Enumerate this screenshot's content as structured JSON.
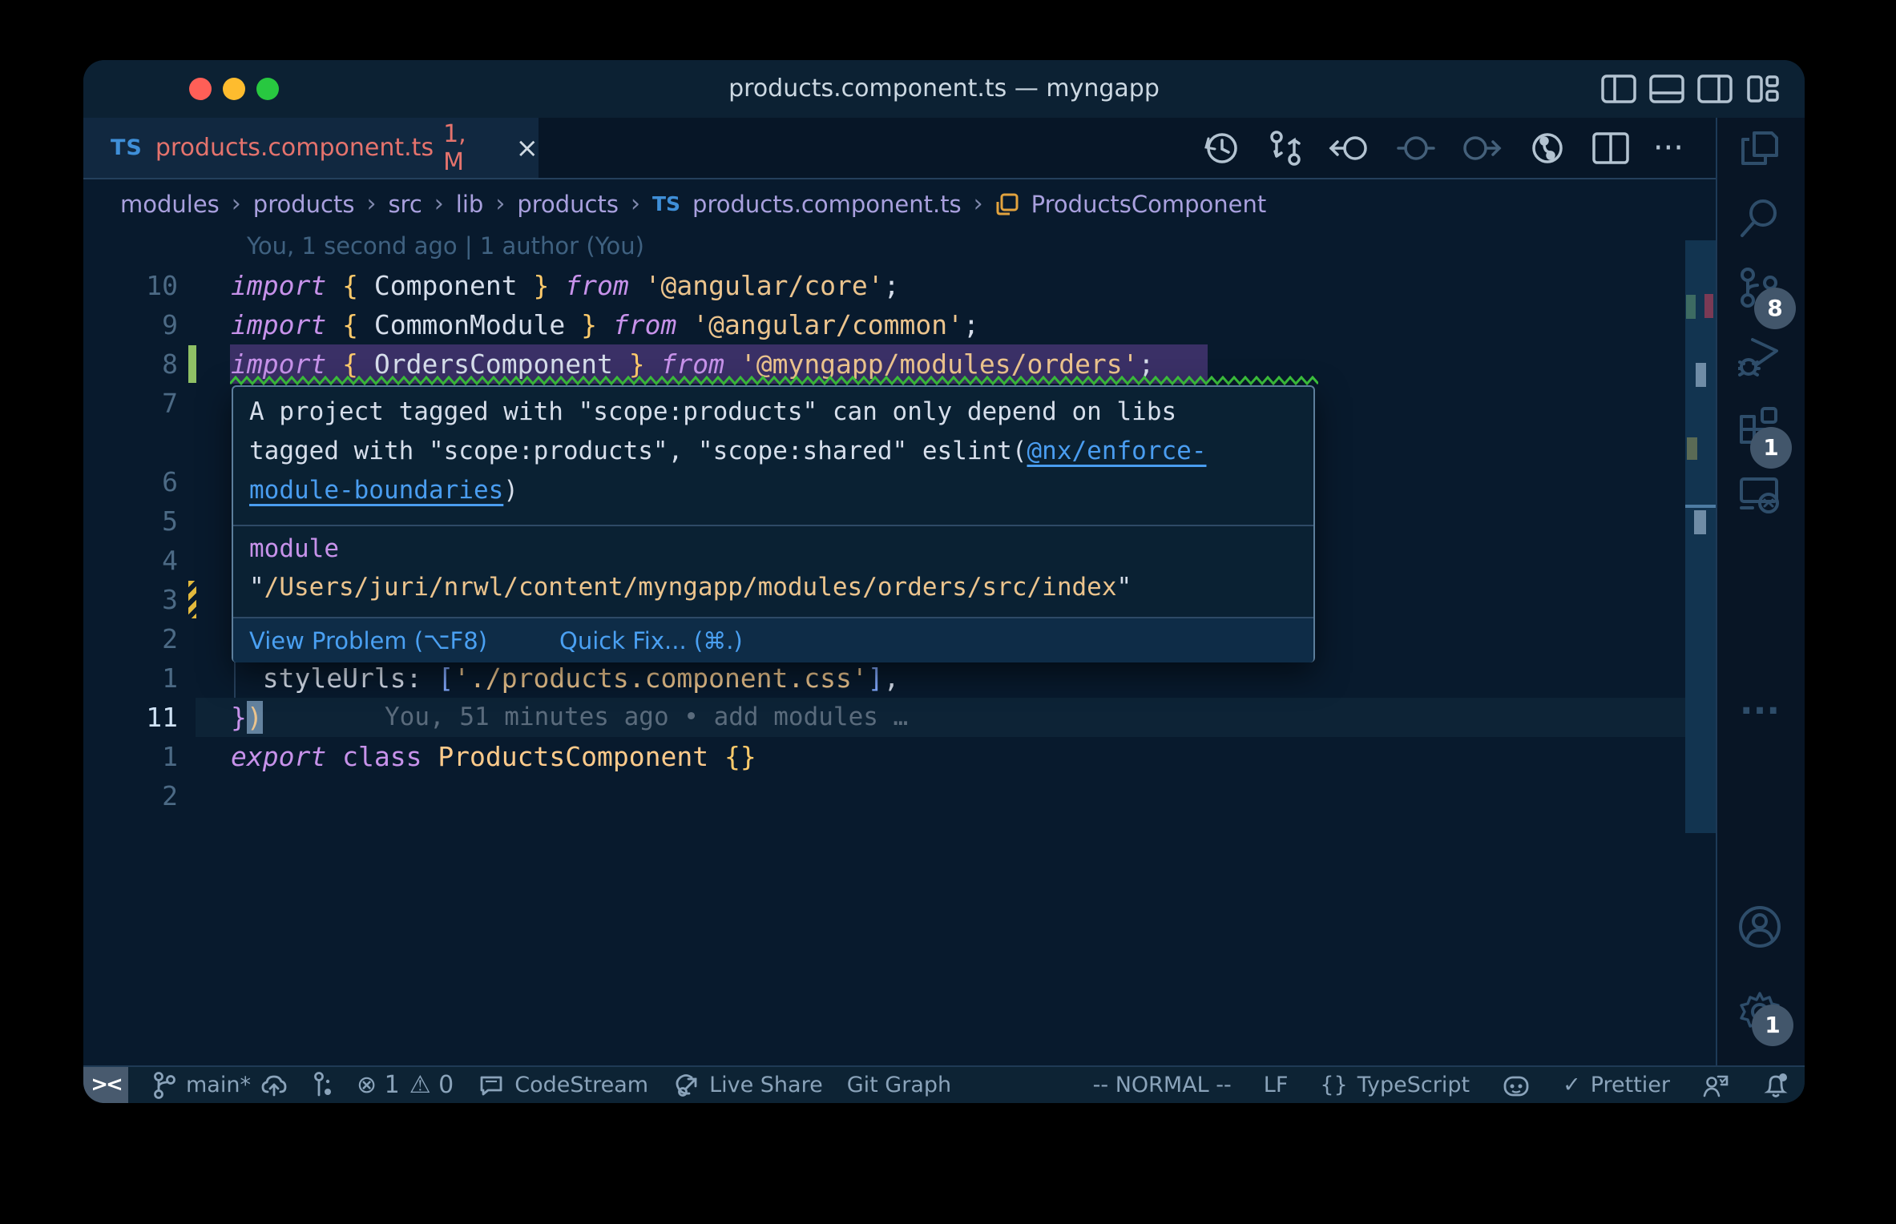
{
  "window": {
    "title": "products.component.ts — myngapp"
  },
  "tab": {
    "type": "TS",
    "label": "products.component.ts",
    "badge": "1, M",
    "close": "×"
  },
  "breadcrumb": {
    "sep": "›",
    "items": [
      "modules",
      "products",
      "src",
      "lib",
      "products",
      "products.component.ts",
      "ProductsComponent"
    ],
    "file_icon": "TS"
  },
  "editor": {
    "blame_top": "You, 1 second ago | 1 author (You)",
    "rows": [
      {
        "g": "",
        "blame_top": true
      },
      {
        "g": "10",
        "tokens": [
          [
            "k",
            "import"
          ],
          [
            "p",
            " "
          ],
          [
            "b",
            "{"
          ],
          [
            "p",
            " "
          ],
          [
            "i",
            "Component"
          ],
          [
            "p",
            " "
          ],
          [
            "b",
            "}"
          ],
          [
            "p",
            " "
          ],
          [
            "k",
            "from"
          ],
          [
            "p",
            " "
          ],
          [
            "s",
            "'@angular/core'"
          ],
          [
            "p",
            ";"
          ]
        ]
      },
      {
        "g": "9",
        "tokens": [
          [
            "k",
            "import"
          ],
          [
            "p",
            " "
          ],
          [
            "b",
            "{"
          ],
          [
            "p",
            " "
          ],
          [
            "i",
            "CommonModule"
          ],
          [
            "p",
            " "
          ],
          [
            "b",
            "}"
          ],
          [
            "p",
            " "
          ],
          [
            "k",
            "from"
          ],
          [
            "p",
            " "
          ],
          [
            "s",
            "'@angular/common'"
          ],
          [
            "p",
            ";"
          ]
        ]
      },
      {
        "g": "8",
        "sel": true,
        "change": "added",
        "tokens": [
          [
            "k",
            "import"
          ],
          [
            "p",
            " "
          ],
          [
            "b",
            "{"
          ],
          [
            "p",
            " "
          ],
          [
            "i",
            "OrdersComponent"
          ],
          [
            "p",
            " "
          ],
          [
            "b",
            "}"
          ],
          [
            "p",
            " "
          ],
          [
            "k",
            "from"
          ],
          [
            "p",
            " "
          ],
          [
            "s",
            "'@myngapp/modules/orders'"
          ],
          [
            "p",
            ";"
          ]
        ]
      },
      {
        "g": "7"
      },
      {
        "g": ""
      },
      {
        "g": "6"
      },
      {
        "g": "5"
      },
      {
        "g": "4"
      },
      {
        "g": "3",
        "change": "modified"
      },
      {
        "g": "2"
      },
      {
        "g": "1",
        "guide": true,
        "tokens": [
          [
            "p",
            "  "
          ],
          [
            "i",
            "styleUrls"
          ],
          [
            "p",
            ": "
          ],
          [
            "a",
            "["
          ],
          [
            "s",
            "'./products.component.css'"
          ],
          [
            "a",
            "]"
          ],
          [
            "p",
            ","
          ]
        ]
      },
      {
        "g": "11",
        "cur": true,
        "cursor": true,
        "tokens": [
          [
            "K",
            "}"
          ],
          [
            "s",
            ")"
          ]
        ],
        "inline_blame": "You, 51 minutes ago • add modules …"
      },
      {
        "g": "1",
        "tokens": [
          [
            "k",
            "export"
          ],
          [
            "p",
            " "
          ],
          [
            "K",
            "class"
          ],
          [
            "p",
            " "
          ],
          [
            "c",
            "ProductsComponent"
          ],
          [
            "p",
            " "
          ],
          [
            "b",
            "{}"
          ]
        ]
      },
      {
        "g": "2"
      }
    ]
  },
  "popup": {
    "message_lines": [
      "A project tagged with \"scope:products\" can only depend on libs",
      "tagged with \"scope:products\", \"scope:shared\" eslint(",
      ""
    ],
    "link_part1": "@nx/enforce-",
    "link_part2": "module-boundaries",
    "close_paren": ")",
    "module_label": "module",
    "quote": "\"",
    "module_path": "/Users/juri/nrwl/content/myngapp/modules/orders/src/index",
    "actions": [
      {
        "label": "View Problem (⌥F8)"
      },
      {
        "label": "Quick Fix... (⌘.)"
      }
    ]
  },
  "activity": {
    "badges": {
      "scm": "8",
      "extensions": "1",
      "settings": "1"
    }
  },
  "status": {
    "remote": "><",
    "branch": "main*",
    "errors": "⊗ 1",
    "warnings": "⚠ 0",
    "codestream": "CodeStream",
    "liveshare": "Live Share",
    "gitgraph": "Git Graph",
    "mode": "-- NORMAL --",
    "eol": "LF",
    "lang_icon": "{}",
    "language": "TypeScript",
    "check": "✓",
    "formatter": "Prettier"
  },
  "colors": {
    "editor_bg": "#081a2d",
    "titlebar_bg": "#0c2133",
    "tab_active_bg": "#112840",
    "tab_text": "#e5736d",
    "ts_blue": "#3f8fd8",
    "breadcrumb_text": "#a9a0de",
    "keyword": "#c792ea",
    "brace": "#ffcb6b",
    "identifier": "#d6deeb",
    "string": "#ecc48d",
    "bracket": "#82aaff",
    "classname": "#ffcb8b",
    "link_blue": "#4a9df0",
    "squiggle_green": "#3ec73e",
    "selection_violet": "#3a3066",
    "added_green": "#8fc065",
    "modified_yellow": "#e2b93d",
    "traffic_red": "#ff5f57",
    "traffic_yellow": "#febc2e",
    "traffic_green": "#28c840",
    "badge_bg": "#42566b",
    "status_fg": "#8aa3ba"
  }
}
